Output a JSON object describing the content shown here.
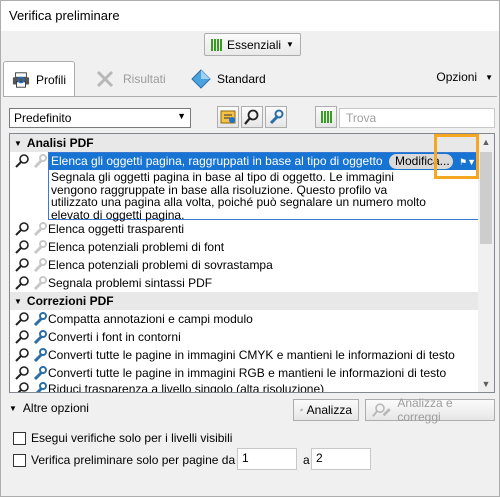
{
  "window": {
    "title": "Verifica preliminare"
  },
  "topbar": {
    "essentials_label": "Essenziali"
  },
  "tabs": [
    {
      "label": "Profili",
      "active": true
    },
    {
      "label": "Risultati",
      "active": false
    },
    {
      "label": "Standard",
      "active": false
    }
  ],
  "options_label": "Opzioni",
  "toolbar": {
    "profile_select": "Predefinito",
    "search_placeholder": "Trova"
  },
  "groups": [
    {
      "label": "Analisi PDF",
      "items": [
        {
          "label": "Elenca gli oggetti pagina, raggruppati in base al tipo di oggetto",
          "selected": true,
          "description": "Segnala gli oggetti pagina in base al tipo di oggetto. Le immagini vengono raggruppate in base alla risoluzione. Questo profilo va utilizzato una pagina alla volta, poiché può segnalare un numero molto elevato di oggetti pagina.",
          "edit_label": "Modifica..."
        },
        {
          "label": "Elenca oggetti trasparenti"
        },
        {
          "label": "Elenca potenziali problemi di font"
        },
        {
          "label": "Elenca potenziali problemi di sovrastampa"
        },
        {
          "label": "Segnala problemi sintassi PDF"
        }
      ]
    },
    {
      "label": "Correzioni PDF",
      "items": [
        {
          "label": "Compatta annotazioni e campi modulo"
        },
        {
          "label": "Converti i font in contorni"
        },
        {
          "label": "Converti tutte le pagine in immagini CMYK e mantieni le informazioni di testo"
        },
        {
          "label": "Converti tutte le pagine in immagini RGB e mantieni le informazioni di testo"
        },
        {
          "label": "Riduci trasparenza a livello singolo (alta risoluzione)"
        }
      ]
    }
  ],
  "bottom": {
    "more_options": "Altre opzioni",
    "analyze_label": "Analizza",
    "analyze_fix_label": "Analizza e correggi",
    "visible_layers_label": "Esegui verifiche solo per i livelli visibili",
    "pages_label": "Verifica preliminare solo per pagine da",
    "page_from": "1",
    "to_label": "a",
    "page_to": "2"
  },
  "colors": {
    "selection": "#1874d2",
    "highlight": "#f5a623",
    "accent_green": "#3a9d23"
  }
}
